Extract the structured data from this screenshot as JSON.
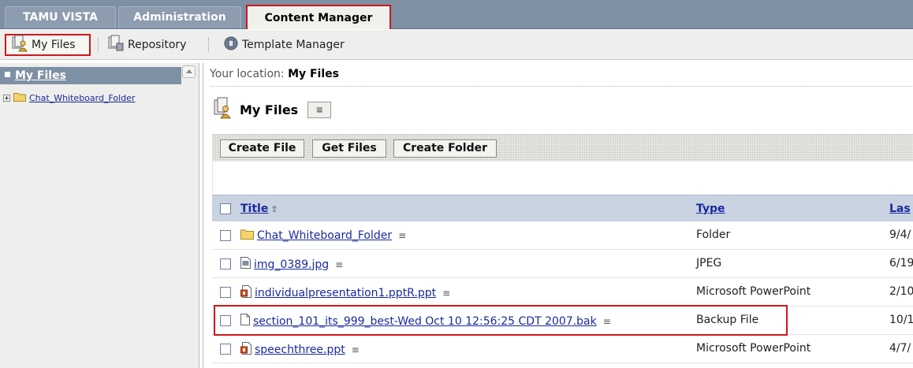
{
  "tabs": {
    "vista": "TAMU VISTA",
    "administration": "Administration",
    "content_manager": "Content Manager"
  },
  "toolbar": {
    "my_files": "My Files",
    "repository": "Repository",
    "template_manager": "Template Manager"
  },
  "left_pane": {
    "heading": "My Files",
    "tree_item": "Chat_Whiteboard_Folder"
  },
  "location": {
    "prefix": "Your location:",
    "value": "My Files"
  },
  "page_title": "My Files",
  "actions": {
    "create_file": "Create File",
    "get_files": "Get Files",
    "create_folder": "Create Folder"
  },
  "table": {
    "columns": {
      "title": "Title",
      "type": "Type",
      "last": "Las"
    },
    "rows": [
      {
        "title": "Chat_Whiteboard_Folder",
        "type": "Folder",
        "last": "9/4/",
        "icon": "folder-icon"
      },
      {
        "title": "img_0389.jpg",
        "type": "JPEG",
        "last": "6/19",
        "icon": "image-file-icon"
      },
      {
        "title": "individualpresentation1.pptR.ppt",
        "type": "Microsoft PowerPoint",
        "last": "2/10",
        "icon": "powerpoint-file-icon"
      },
      {
        "title": "section_101_its_999_best-Wed Oct 10 12:56:25 CDT 2007.bak",
        "type": "Backup File",
        "last": "10/1",
        "icon": "blank-file-icon"
      },
      {
        "title": "speechthree.ppt",
        "type": "Microsoft PowerPoint",
        "last": "4/7/",
        "icon": "powerpoint-file-icon"
      }
    ]
  },
  "colors": {
    "tab_bar": "#7e90a4",
    "highlight": "#d0161c",
    "header_row": "#c9d2e1",
    "link": "#1a2a9c"
  }
}
